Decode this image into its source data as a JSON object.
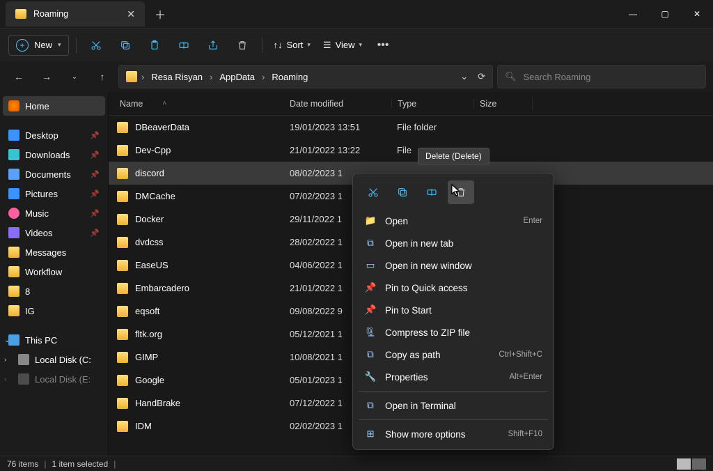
{
  "tab": {
    "title": "Roaming"
  },
  "toolbar": {
    "new": "New",
    "sort": "Sort",
    "view": "View"
  },
  "breadcrumb": {
    "items": [
      "Resa Risyan",
      "AppData",
      "Roaming"
    ]
  },
  "search": {
    "placeholder": "Search Roaming"
  },
  "sidebar": {
    "home": "Home",
    "quick": [
      {
        "label": "Desktop"
      },
      {
        "label": "Downloads"
      },
      {
        "label": "Documents"
      },
      {
        "label": "Pictures"
      },
      {
        "label": "Music"
      },
      {
        "label": "Videos"
      },
      {
        "label": "Messages"
      },
      {
        "label": "Workflow"
      },
      {
        "label": "8"
      },
      {
        "label": "IG"
      }
    ],
    "thispc": "This PC",
    "drives": [
      {
        "label": "Local Disk (C:"
      },
      {
        "label": "Local Disk (E:"
      }
    ]
  },
  "columns": {
    "name": "Name",
    "date": "Date modified",
    "type": "Type",
    "size": "Size"
  },
  "rows": [
    {
      "name": "DBeaverData",
      "date": "19/01/2023 13:51",
      "type": "File folder"
    },
    {
      "name": "Dev-Cpp",
      "date": "21/01/2022 13:22",
      "type": "File"
    },
    {
      "name": "discord",
      "date": "08/02/2023 1",
      "type": "",
      "selected": true
    },
    {
      "name": "DMCache",
      "date": "07/02/2023 1",
      "type": ""
    },
    {
      "name": "Docker",
      "date": "29/11/2022 1",
      "type": ""
    },
    {
      "name": "dvdcss",
      "date": "28/02/2022 1",
      "type": ""
    },
    {
      "name": "EaseUS",
      "date": "04/06/2022 1",
      "type": ""
    },
    {
      "name": "Embarcadero",
      "date": "21/01/2022 1",
      "type": ""
    },
    {
      "name": "eqsoft",
      "date": "09/08/2022 9",
      "type": ""
    },
    {
      "name": "fltk.org",
      "date": "05/12/2021 1",
      "type": ""
    },
    {
      "name": "GIMP",
      "date": "10/08/2021 1",
      "type": ""
    },
    {
      "name": "Google",
      "date": "05/01/2023 1",
      "type": ""
    },
    {
      "name": "HandBrake",
      "date": "07/12/2022 1",
      "type": ""
    },
    {
      "name": "IDM",
      "date": "02/02/2023 1",
      "type": ""
    }
  ],
  "tooltip": "Delete (Delete)",
  "context_menu": {
    "items": [
      {
        "label": "Open",
        "shortcut": "Enter",
        "icon": "folder"
      },
      {
        "label": "Open in new tab",
        "icon": "tab"
      },
      {
        "label": "Open in new window",
        "icon": "window"
      },
      {
        "label": "Pin to Quick access",
        "icon": "pin"
      },
      {
        "label": "Pin to Start",
        "icon": "pin"
      },
      {
        "label": "Compress to ZIP file",
        "icon": "zip"
      },
      {
        "label": "Copy as path",
        "shortcut": "Ctrl+Shift+C",
        "icon": "path"
      },
      {
        "label": "Properties",
        "shortcut": "Alt+Enter",
        "icon": "wrench"
      }
    ],
    "terminal": {
      "label": "Open in Terminal"
    },
    "more": {
      "label": "Show more options",
      "shortcut": "Shift+F10"
    }
  },
  "status": {
    "count": "76 items",
    "selected": "1 item selected"
  }
}
